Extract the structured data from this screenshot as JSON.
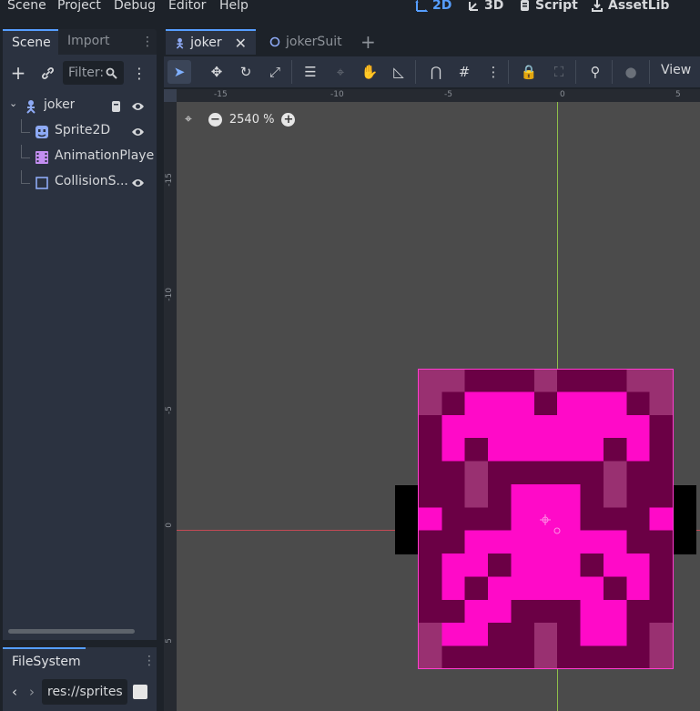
{
  "menubar": {
    "items": [
      "Scene",
      "Project",
      "Debug",
      "Editor",
      "Help"
    ],
    "workspaces": [
      {
        "label": "2D",
        "icon": "2d-icon",
        "active": true
      },
      {
        "label": "3D",
        "icon": "3d-icon",
        "active": false
      },
      {
        "label": "Script",
        "icon": "script-icon",
        "active": false
      },
      {
        "label": "AssetLib",
        "icon": "assetlib-icon",
        "active": false
      }
    ]
  },
  "scene_dock": {
    "tabs": [
      "Scene",
      "Import"
    ],
    "filter_placeholder": "Filter:",
    "tree": [
      {
        "label": "joker",
        "icon": "node2d-icon",
        "expanded": true
      },
      {
        "label": "Sprite2D",
        "icon": "sprite2d-icon"
      },
      {
        "label": "AnimationPlayer",
        "icon": "animationplayer-icon"
      },
      {
        "label": "CollisionS...",
        "icon": "collisionshape-icon"
      }
    ]
  },
  "filesystem_dock": {
    "tab": "FileSystem",
    "path": "res://sprites"
  },
  "editor": {
    "tabs": [
      {
        "label": "joker",
        "icon": "node2d-icon",
        "active": true
      },
      {
        "label": "jokerSuit",
        "icon": "circle-icon",
        "active": false
      }
    ],
    "view_label": "View",
    "zoom_label": "2540 %",
    "ruler_top": [
      "-15",
      "-10",
      "-5",
      "0",
      "5"
    ],
    "ruler_left": [
      "-15",
      "-10",
      "-5",
      "0",
      "5"
    ]
  },
  "colors": {
    "accent": "#569eff",
    "pink": "#ff0ac8",
    "dark": "#6b0045",
    "mid": "#993071",
    "viewport_bg": "#4b4b4b"
  }
}
